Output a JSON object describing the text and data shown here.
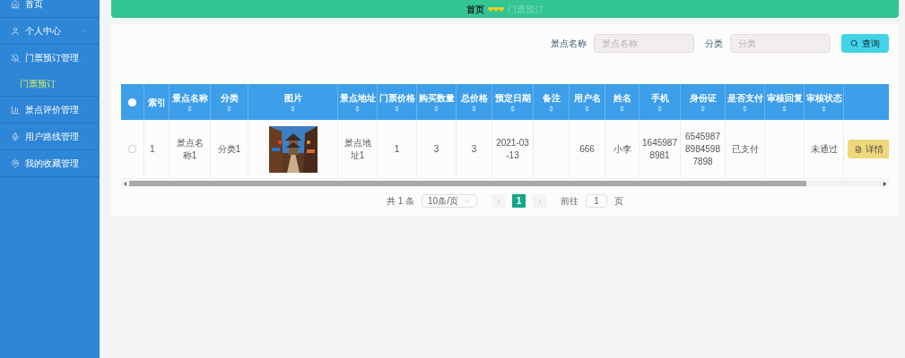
{
  "sidebar": {
    "items": [
      {
        "label": "首页",
        "has_children": false
      },
      {
        "label": "个人中心",
        "expanded": false,
        "has_children": true
      },
      {
        "label": "门票预订管理",
        "expanded": true,
        "has_children": true,
        "children": [
          {
            "label": "门票预订",
            "selected": true
          }
        ]
      },
      {
        "label": "景点评价管理",
        "expanded": false,
        "has_children": true
      },
      {
        "label": "用户路线管理",
        "expanded": false,
        "has_children": true
      },
      {
        "label": "我的收藏管理",
        "expanded": false,
        "has_children": true
      }
    ]
  },
  "breadcrumb": [
    "首页",
    "门票预订"
  ],
  "search": {
    "fields": [
      {
        "label": "景点名称",
        "placeholder": "景点名称"
      },
      {
        "label": "分类",
        "placeholder": "分类"
      }
    ],
    "button": "查询"
  },
  "table": {
    "header_checkbox": {
      "checked": false
    },
    "columns": [
      {
        "label": "索引",
        "sortable": false
      },
      {
        "label": "景点名称",
        "sortable": true
      },
      {
        "label": "分类",
        "sortable": true
      },
      {
        "label": "图片",
        "sortable": true
      },
      {
        "label": "景点地址",
        "sortable": true
      },
      {
        "label": "门票价格",
        "sortable": true
      },
      {
        "label": "购买数量",
        "sortable": true
      },
      {
        "label": "总价格",
        "sortable": true
      },
      {
        "label": "预定日期",
        "sortable": true
      },
      {
        "label": "备注",
        "sortable": true
      },
      {
        "label": "用户名",
        "sortable": true
      },
      {
        "label": "姓名",
        "sortable": true
      },
      {
        "label": "手机",
        "sortable": true
      },
      {
        "label": "身份证",
        "sortable": true
      },
      {
        "label": "是否支付",
        "sortable": true
      },
      {
        "label": "审核回复",
        "sortable": true
      },
      {
        "label": "审核状态",
        "sortable": true
      }
    ],
    "rows": [
      {
        "checked": false,
        "cells": [
          {
            "kind": "text",
            "text": "1"
          },
          {
            "kind": "text",
            "text": "景点名称1"
          },
          {
            "kind": "text",
            "text": "分类1"
          },
          {
            "kind": "picture"
          },
          {
            "kind": "text",
            "text": "景点地址1"
          },
          {
            "kind": "text",
            "text": "1"
          },
          {
            "kind": "text",
            "text": "3"
          },
          {
            "kind": "text",
            "text": "3"
          },
          {
            "kind": "text",
            "text": "2021-03-13"
          },
          {
            "kind": "empty"
          },
          {
            "kind": "text",
            "text": "666"
          },
          {
            "kind": "text",
            "text": "小李"
          },
          {
            "kind": "text",
            "text": "16459878981"
          },
          {
            "kind": "text",
            "text": "654598789845987898"
          },
          {
            "kind": "text",
            "text": "已支付"
          },
          {
            "kind": "empty"
          },
          {
            "kind": "text",
            "text": "未通过"
          }
        ],
        "action": "详情"
      }
    ]
  },
  "pagination": {
    "total": "共 1 条",
    "page_size": "10条/页",
    "pages": [
      {
        "label": "1",
        "selected": true
      }
    ],
    "goto_label": "前往",
    "goto_value": "1",
    "goto_suffix": "页"
  }
}
